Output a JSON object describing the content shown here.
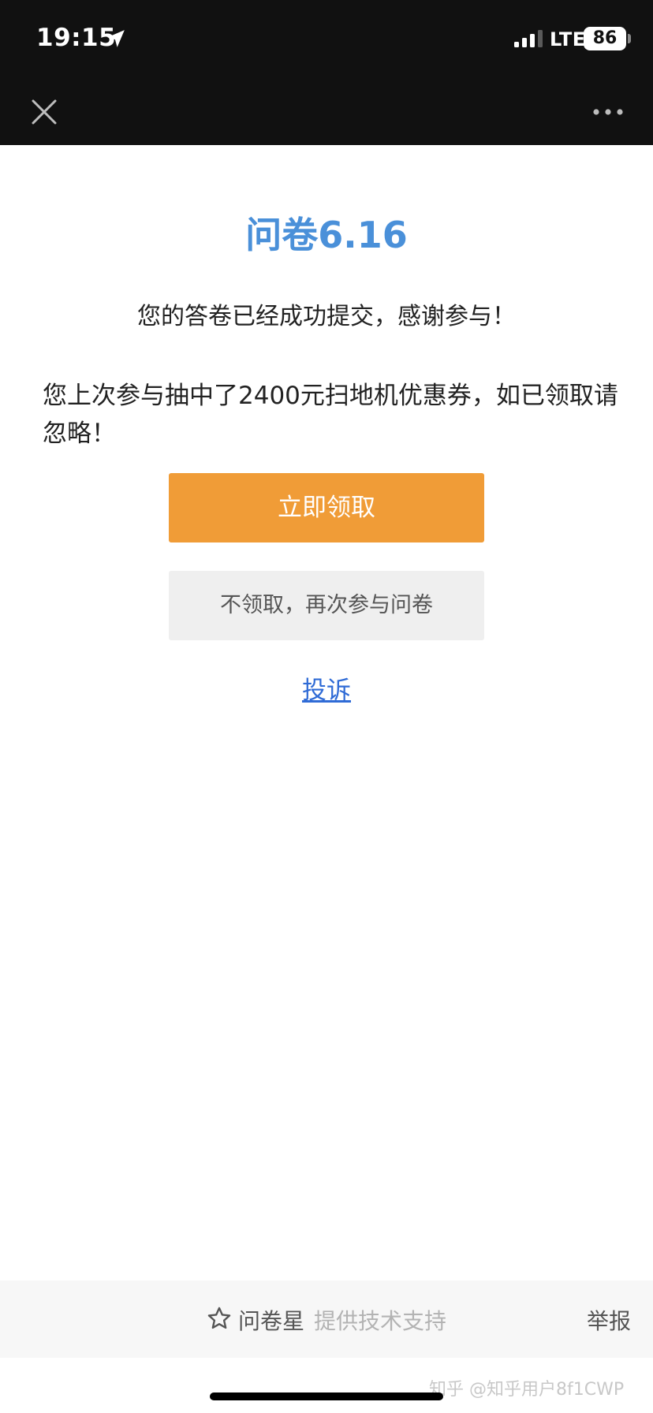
{
  "status_bar": {
    "time": "19:15",
    "network": "LTE",
    "battery": "86"
  },
  "nav_bar": {
    "close_icon": "close-icon",
    "more_icon": "more-horizontal-icon"
  },
  "content": {
    "title": "问卷6.16",
    "submit_message": "您的答卷已经成功提交，感谢参与！",
    "prize_message": "您上次参与抽中了2400元扫地机优惠券，如已领取请忽略！",
    "claim_button": "立即领取",
    "decline_button": "不领取，再次参与问卷",
    "complaint_link": "投诉"
  },
  "footer": {
    "brand": "问卷星",
    "tech_support": "提供技术支持",
    "report": "举报"
  },
  "watermark": "知乎 @知乎用户8f1CWP",
  "colors": {
    "title": "#4a90d9",
    "claim_button": "#f09c37",
    "decline_button": "#efefef",
    "link": "#2f6bd6",
    "bar_background": "#111111"
  }
}
